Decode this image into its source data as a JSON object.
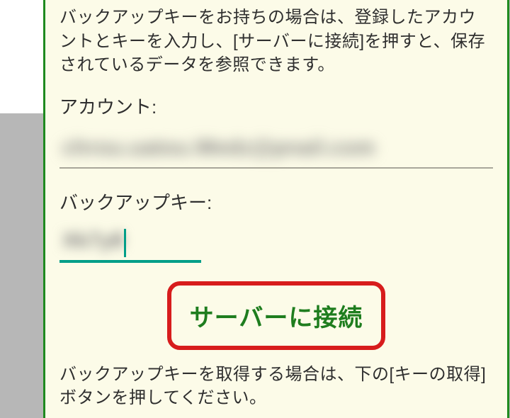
{
  "dialog": {
    "intro": "バックアップキーをお持ちの場合は、登録したアカウントとキーを入力し、[サーバーに接続]を押すと、保存されているデータを参照できます。",
    "account_label": "アカウント:",
    "account_value": "chrou.uatou.Wedz@pnail.com",
    "key_label": "バックアップキー:",
    "key_value": "Xk7y8",
    "submit_label": "サーバーに接続",
    "hint": "バックアップキーを取得する場合は、下の[キーの取得]ボタンを押してください。",
    "accent_color": "#009e88",
    "highlight_border": "#d71c1c",
    "primary_text_color": "#1e7d1e"
  }
}
